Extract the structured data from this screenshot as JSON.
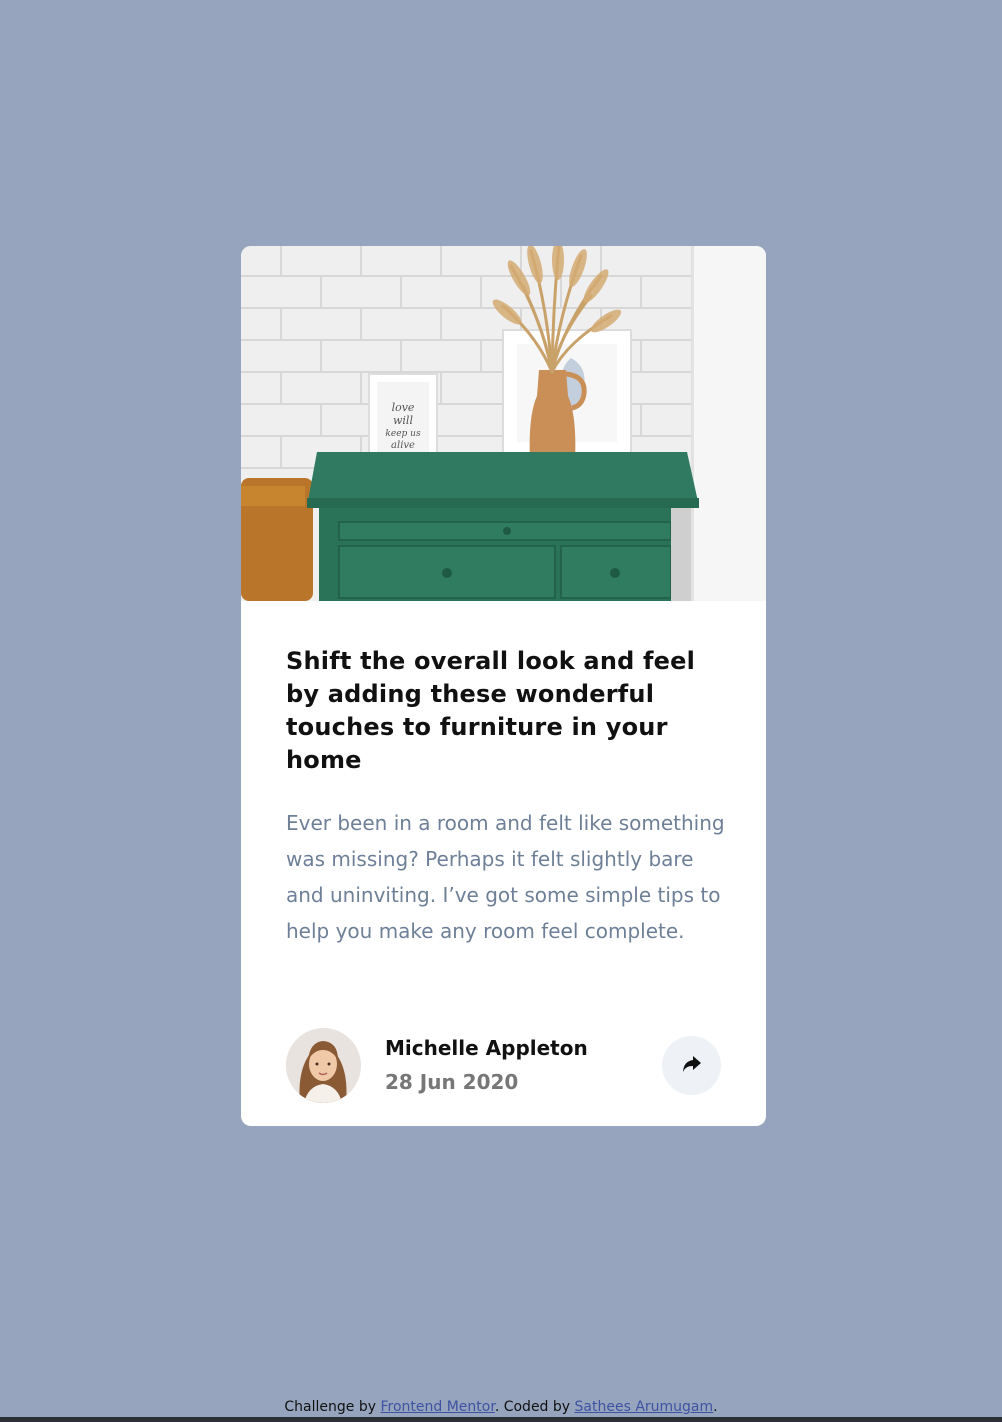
{
  "card": {
    "image_alt": "drawers",
    "title": "Shift the overall look and feel by adding these wonderful touches to furniture in your home",
    "description": "Ever been in a room and felt like something was missing? Perhaps it felt slightly bare and uninviting. I’ve got some simple tips to help you make any room feel complete.",
    "author": {
      "name": "Michelle Appleton",
      "date": "28 Jun 2020",
      "avatar_alt": "avatar-michelle"
    },
    "share_icon": "share-icon"
  },
  "attribution": {
    "prefix": "Challenge by ",
    "link1": "Frontend Mentor",
    "middle": ". Coded by ",
    "link2": "Sathees Arumugam",
    "suffix": "."
  },
  "colors": {
    "background": "#96a5bd",
    "card": "#ffffff",
    "title": "#111111",
    "description": "#6e8098",
    "date": "#777777",
    "share_bg": "#eef1f5",
    "link": "#3e52a3"
  }
}
